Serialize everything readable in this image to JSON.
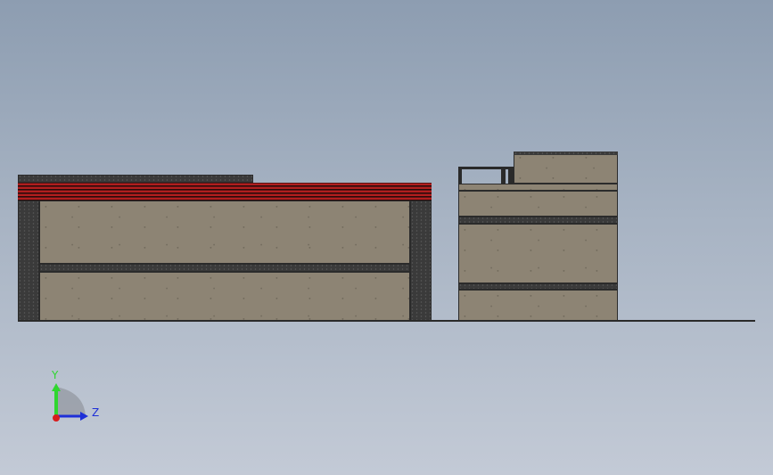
{
  "viewport": {
    "background_top": "#8d9db1",
    "background_bottom": "#c3cad6"
  },
  "triad": {
    "y_label": "Y",
    "z_label": "Z",
    "y_color": "#2fd62f",
    "z_color": "#1d2fd8",
    "x_color": "#d81d1d"
  },
  "colors": {
    "concrete": "#8d8474",
    "dark_band": "#3a3a3a",
    "roof_red": "#b01e1e"
  }
}
